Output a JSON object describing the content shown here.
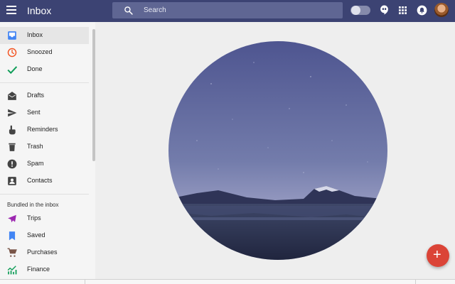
{
  "header": {
    "title": "Inbox",
    "search_placeholder": "Search"
  },
  "sidebar": {
    "items": [
      {
        "label": "Inbox",
        "icon": "inbox-icon",
        "active": true
      },
      {
        "label": "Snoozed",
        "icon": "clock-icon"
      },
      {
        "label": "Done",
        "icon": "check-icon"
      },
      {
        "label": "Drafts",
        "icon": "drafts-icon"
      },
      {
        "label": "Sent",
        "icon": "send-icon"
      },
      {
        "label": "Reminders",
        "icon": "reminder-hand-icon"
      },
      {
        "label": "Trash",
        "icon": "trash-icon"
      },
      {
        "label": "Spam",
        "icon": "spam-icon"
      },
      {
        "label": "Contacts",
        "icon": "contacts-icon"
      }
    ],
    "bundled_label": "Bundled in the inbox",
    "bundles": [
      {
        "label": "Trips",
        "icon": "plane-icon",
        "color": "#9c27b0"
      },
      {
        "label": "Saved",
        "icon": "bookmark-icon",
        "color": "#4285f4"
      },
      {
        "label": "Purchases",
        "icon": "cart-icon",
        "color": "#795548"
      },
      {
        "label": "Finance",
        "icon": "chart-icon",
        "color": "#0f9d58"
      }
    ]
  },
  "fab": {
    "label": "+"
  },
  "colors": {
    "topbar": "#3c4373",
    "fab": "#db4437"
  }
}
